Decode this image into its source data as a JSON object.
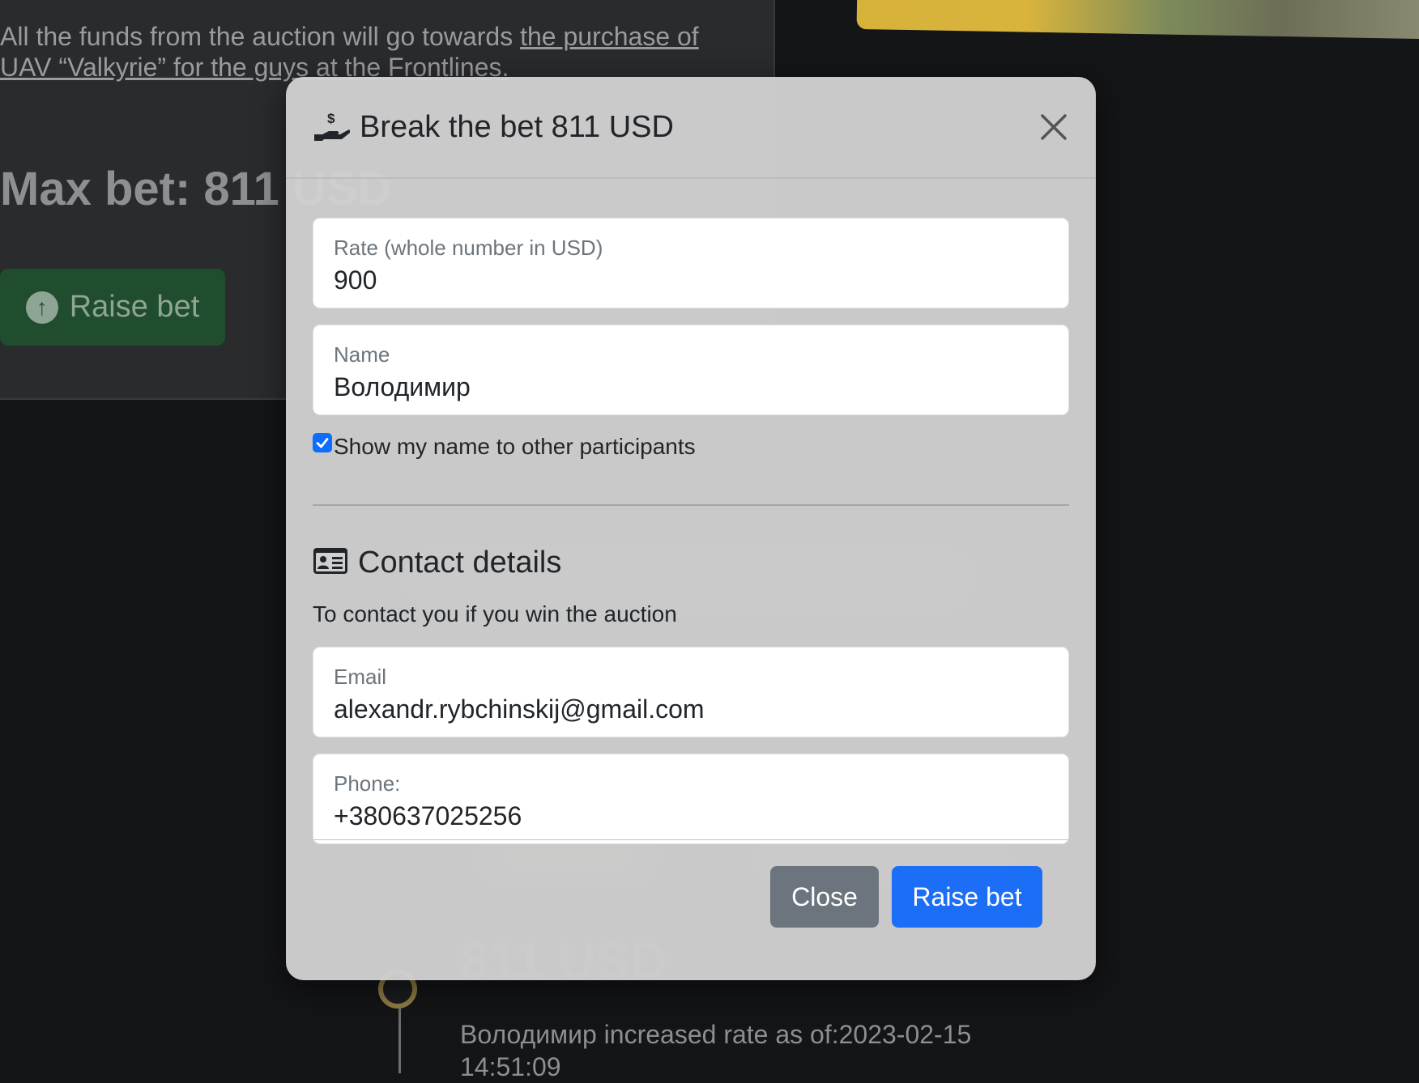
{
  "background": {
    "description_prefix": "All the funds from the auction will go towards ",
    "description_link": "the purchase of UAV “Valkyrie” for the guys at the Frontlines.",
    "max_bet": "Max bet: 811 USD",
    "raise_button": "Raise bet",
    "entry_amount": "811 USD",
    "entry_text": "Володимир increased rate as of:2023-02-15 14:51:09"
  },
  "modal": {
    "title": "Break the bet 811 USD",
    "rate_label": "Rate (whole number in USD)",
    "rate_value": "900",
    "name_label": "Name",
    "name_value": "Володимир",
    "show_name_label": "Show my name to other participants",
    "show_name_checked": true,
    "contact_title": "Contact details",
    "contact_subtitle": "To contact you if you win the auction",
    "email_label": "Email",
    "email_value": "alexandr.rybchinskij@gmail.com",
    "phone_label": "Phone:",
    "phone_value": "+380637025256",
    "close_button": "Close",
    "raise_button": "Raise bet"
  },
  "colors": {
    "primary": "#1d6ef7",
    "secondary": "#6c757d",
    "success_dark": "#1f4d2e"
  },
  "icons": [
    "hand-holding-dollar-icon",
    "close-icon",
    "id-card-icon",
    "check-icon",
    "arrow-up-circle-icon"
  ]
}
